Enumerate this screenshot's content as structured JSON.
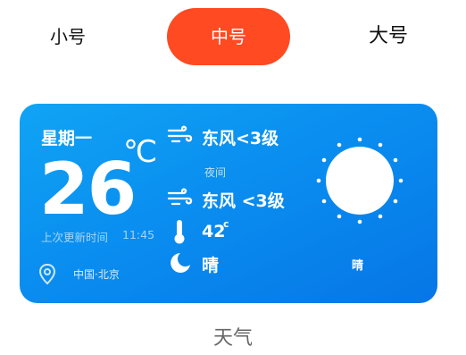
{
  "tabs": {
    "small": "小号",
    "medium": "中号",
    "large": "大号"
  },
  "widget": {
    "weekday": "星期一",
    "temperature": "26",
    "temperature_unit": "℃",
    "updated_label": "上次更新时间",
    "updated_time": "11:45",
    "location": "中国·北京",
    "day_wind": "东风<3级",
    "night_label": "夜间",
    "night_wind": "东风 <3级",
    "night_temp": "42",
    "night_temp_unit": "c",
    "night_condition": "晴",
    "day_condition": "晴",
    "icons": [
      "wind-icon",
      "thermometer-icon",
      "moon-icon",
      "sun-icon",
      "location-pin-icon"
    ]
  },
  "caption": "天气",
  "colors": {
    "accent": "#ff4a22",
    "card_blue": "#0a8ef0"
  }
}
